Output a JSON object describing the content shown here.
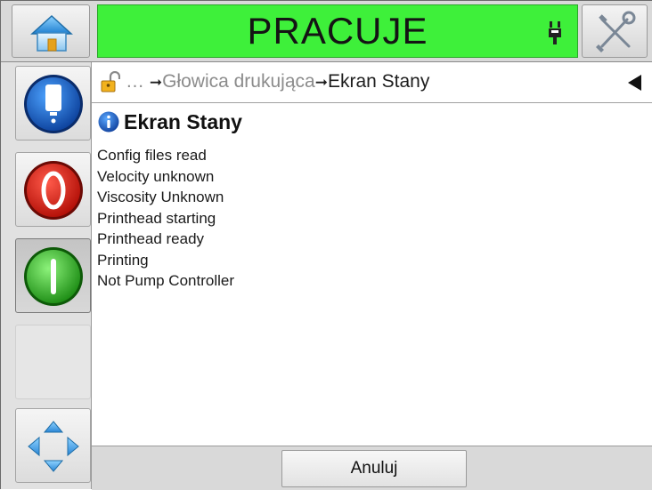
{
  "header": {
    "status_text": "PRACUJE",
    "status_color": "#3ef03a",
    "home_icon": "home-icon",
    "tools_icon": "tools-icon",
    "plug_icon": "printhead-plug-icon"
  },
  "sidebar": {
    "buttons": [
      {
        "icon": "printhead-icon"
      },
      {
        "icon": "stop-icon"
      },
      {
        "icon": "start-icon"
      },
      {
        "icon": "empty"
      },
      {
        "icon": "navigation-arrows-icon"
      }
    ]
  },
  "breadcrumb": {
    "ellipsis": "…",
    "parent": "Głowica drukująca",
    "current": "Ekran Stany"
  },
  "page": {
    "title": "Ekran Stany",
    "status_lines": [
      "Config files read",
      "Velocity unknown",
      "Viscosity Unknown",
      "Printhead starting",
      "Printhead ready",
      "Printing",
      "Not Pump Controller"
    ]
  },
  "footer": {
    "cancel_label": "Anuluj"
  }
}
